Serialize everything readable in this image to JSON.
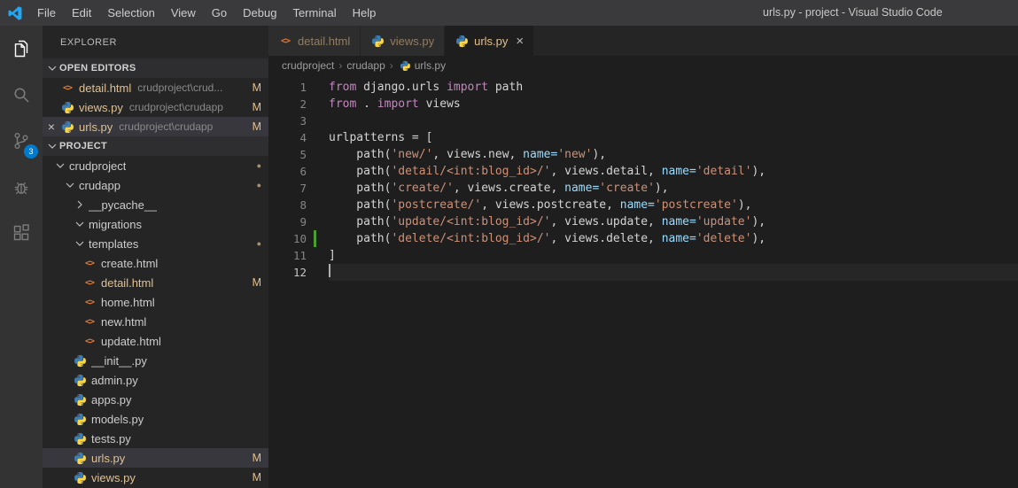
{
  "colors": {
    "accent": "#007acc",
    "modified": "#e2c08d",
    "keyword": "#c586c0",
    "string": "#ce9178",
    "parameter": "#9cdcfe",
    "text": "#d4d4d4",
    "added-marker": "#4b9e2d"
  },
  "title_bar": {
    "menus": [
      "File",
      "Edit",
      "Selection",
      "View",
      "Go",
      "Debug",
      "Terminal",
      "Help"
    ],
    "window_title": "urls.py - project - Visual Studio Code"
  },
  "activity_bar": {
    "items": [
      {
        "name": "explorer",
        "active": true
      },
      {
        "name": "search",
        "active": false
      },
      {
        "name": "source-control",
        "active": false,
        "badge": "3"
      },
      {
        "name": "debug",
        "active": false
      },
      {
        "name": "extensions",
        "active": false
      }
    ]
  },
  "sidebar": {
    "title": "EXPLORER",
    "sections": {
      "open_editors": {
        "label": "OPEN EDITORS",
        "items": [
          {
            "name": "detail.html",
            "description": "crudproject\\crud...",
            "icon": "html",
            "badge": "M",
            "modified": true,
            "active": false
          },
          {
            "name": "views.py",
            "description": "crudproject\\crudapp",
            "icon": "python",
            "badge": "M",
            "modified": true,
            "active": false
          },
          {
            "name": "urls.py",
            "description": "crudproject\\crudapp",
            "icon": "python",
            "badge": "M",
            "modified": true,
            "active": true
          }
        ]
      },
      "project": {
        "label": "PROJECT",
        "tree": [
          {
            "label": "crudproject",
            "type": "folder",
            "level": 0,
            "expanded": true,
            "dot": true
          },
          {
            "label": "crudapp",
            "type": "folder",
            "level": 1,
            "expanded": true,
            "dot": true
          },
          {
            "label": "__pycache__",
            "type": "folder",
            "level": 2,
            "expanded": false
          },
          {
            "label": "migrations",
            "type": "folder",
            "level": 2,
            "expanded": true
          },
          {
            "label": "templates",
            "type": "folder",
            "level": 2,
            "expanded": true,
            "dot": true
          },
          {
            "label": "create.html",
            "type": "file",
            "icon": "html",
            "level": 3
          },
          {
            "label": "detail.html",
            "type": "file",
            "icon": "html",
            "level": 3,
            "badge": "M",
            "modified": true
          },
          {
            "label": "home.html",
            "type": "file",
            "icon": "html",
            "level": 3
          },
          {
            "label": "new.html",
            "type": "file",
            "icon": "html",
            "level": 3
          },
          {
            "label": "update.html",
            "type": "file",
            "icon": "html",
            "level": 3
          },
          {
            "label": "__init__.py",
            "type": "file",
            "icon": "python",
            "level": 2
          },
          {
            "label": "admin.py",
            "type": "file",
            "icon": "python",
            "level": 2
          },
          {
            "label": "apps.py",
            "type": "file",
            "icon": "python",
            "level": 2
          },
          {
            "label": "models.py",
            "type": "file",
            "icon": "python",
            "level": 2
          },
          {
            "label": "tests.py",
            "type": "file",
            "icon": "python",
            "level": 2
          },
          {
            "label": "urls.py",
            "type": "file",
            "icon": "python",
            "level": 2,
            "badge": "M",
            "modified": true,
            "selected": true
          },
          {
            "label": "views.py",
            "type": "file",
            "icon": "python",
            "level": 2,
            "badge": "M",
            "modified": true
          }
        ]
      }
    }
  },
  "editor": {
    "tabs": [
      {
        "label": "detail.html",
        "icon": "html",
        "active": false,
        "modified": true
      },
      {
        "label": "views.py",
        "icon": "python",
        "active": false,
        "modified": true
      },
      {
        "label": "urls.py",
        "icon": "python",
        "active": true,
        "modified": true
      }
    ],
    "breadcrumb": [
      {
        "label": "crudproject"
      },
      {
        "label": "crudapp"
      },
      {
        "label": "urls.py",
        "icon": "python"
      }
    ],
    "code": {
      "language": "python",
      "lines": [
        {
          "num": 1,
          "segments": [
            [
              "k",
              "from"
            ],
            [
              "p",
              " django.urls "
            ],
            [
              "k",
              "import"
            ],
            [
              "p",
              " path"
            ]
          ]
        },
        {
          "num": 2,
          "segments": [
            [
              "k",
              "from"
            ],
            [
              "p",
              " . "
            ],
            [
              "k",
              "import"
            ],
            [
              "p",
              " views"
            ]
          ]
        },
        {
          "num": 3,
          "segments": []
        },
        {
          "num": 4,
          "segments": [
            [
              "p",
              "urlpatterns = ["
            ]
          ]
        },
        {
          "num": 5,
          "segments": [
            [
              "p",
              "    path("
            ],
            [
              "s",
              "'new/'"
            ],
            [
              "p",
              ", views.new, "
            ],
            [
              "a",
              "name="
            ],
            [
              "s",
              "'new'"
            ],
            [
              "p",
              "),"
            ]
          ]
        },
        {
          "num": 6,
          "segments": [
            [
              "p",
              "    path("
            ],
            [
              "s",
              "'detail/<int:blog_id>/'"
            ],
            [
              "p",
              ", views.detail, "
            ],
            [
              "a",
              "name="
            ],
            [
              "s",
              "'detail'"
            ],
            [
              "p",
              "),"
            ]
          ]
        },
        {
          "num": 7,
          "segments": [
            [
              "p",
              "    path("
            ],
            [
              "s",
              "'create/'"
            ],
            [
              "p",
              ", views.create, "
            ],
            [
              "a",
              "name="
            ],
            [
              "s",
              "'create'"
            ],
            [
              "p",
              "),"
            ]
          ]
        },
        {
          "num": 8,
          "segments": [
            [
              "p",
              "    path("
            ],
            [
              "s",
              "'postcreate/'"
            ],
            [
              "p",
              ", views.postcreate, "
            ],
            [
              "a",
              "name="
            ],
            [
              "s",
              "'postcreate'"
            ],
            [
              "p",
              "),"
            ]
          ]
        },
        {
          "num": 9,
          "segments": [
            [
              "p",
              "    path("
            ],
            [
              "s",
              "'update/<int:blog_id>/'"
            ],
            [
              "p",
              ", views.update, "
            ],
            [
              "a",
              "name="
            ],
            [
              "s",
              "'update'"
            ],
            [
              "p",
              "),"
            ]
          ]
        },
        {
          "num": 10,
          "segments": [
            [
              "p",
              "    path("
            ],
            [
              "s",
              "'delete/<int:blog_id>/'"
            ],
            [
              "p",
              ", views.delete, "
            ],
            [
              "a",
              "name="
            ],
            [
              "s",
              "'delete'"
            ],
            [
              "p",
              "),"
            ]
          ],
          "added_marker": true
        },
        {
          "num": 11,
          "segments": [
            [
              "p",
              "]"
            ]
          ]
        },
        {
          "num": 12,
          "segments": [],
          "cursor": true,
          "current": true
        }
      ]
    }
  }
}
